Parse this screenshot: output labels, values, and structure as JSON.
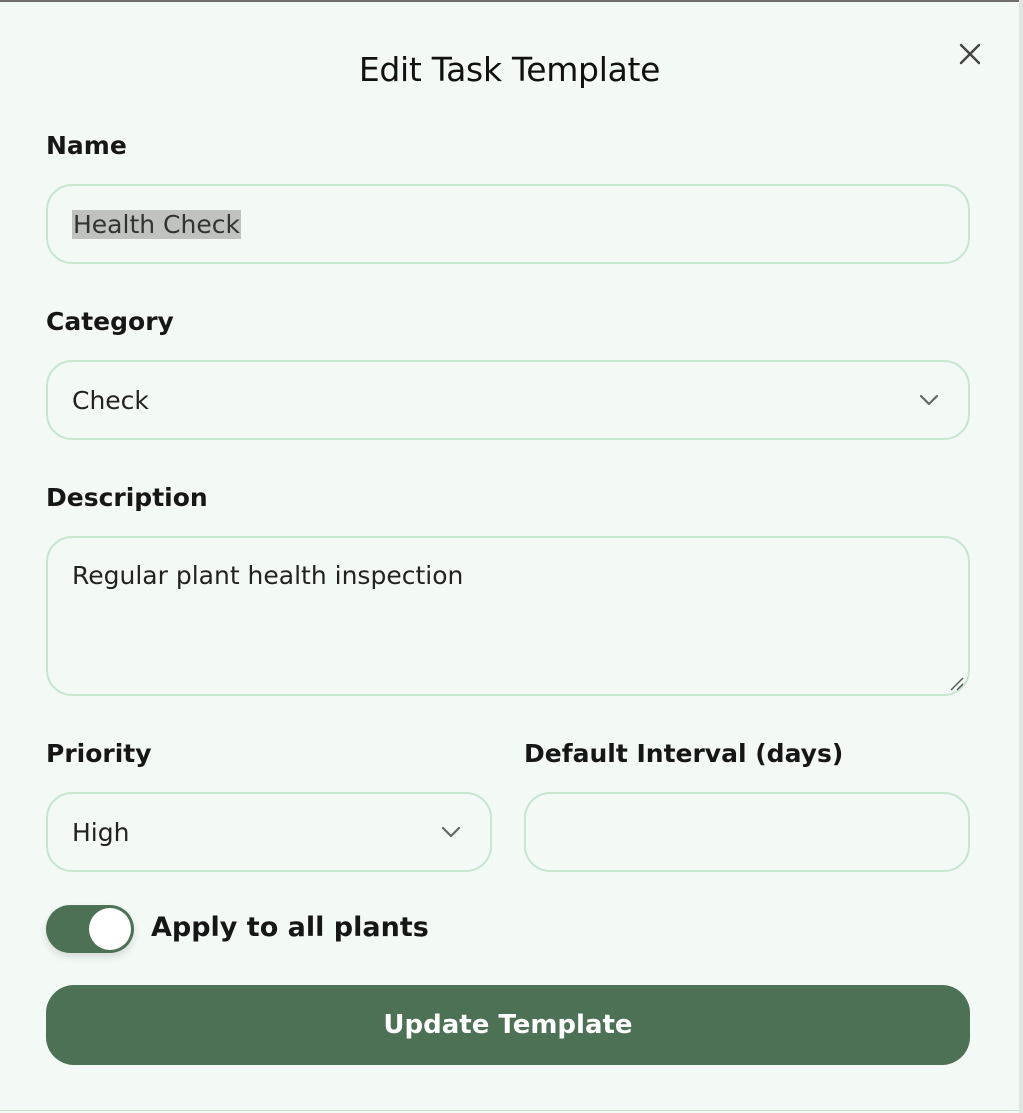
{
  "dialog": {
    "title": "Edit Task Template",
    "close_icon": "close-icon"
  },
  "form": {
    "name": {
      "label": "Name",
      "value": "Health Check"
    },
    "category": {
      "label": "Category",
      "value": "Check",
      "icon": "chevron-down-icon"
    },
    "description": {
      "label": "Description",
      "value": "Regular plant health inspection"
    },
    "priority": {
      "label": "Priority",
      "value": "High",
      "icon": "chevron-down-icon"
    },
    "interval": {
      "label": "Default Interval (days)",
      "value": ""
    },
    "apply_all": {
      "label": "Apply to all plants",
      "checked": true
    },
    "submit_label": "Update Template"
  },
  "colors": {
    "background": "#f3f9f4",
    "field_border": "#c6e6cf",
    "accent": "#4d7154",
    "selection": "#bfc2bf"
  }
}
